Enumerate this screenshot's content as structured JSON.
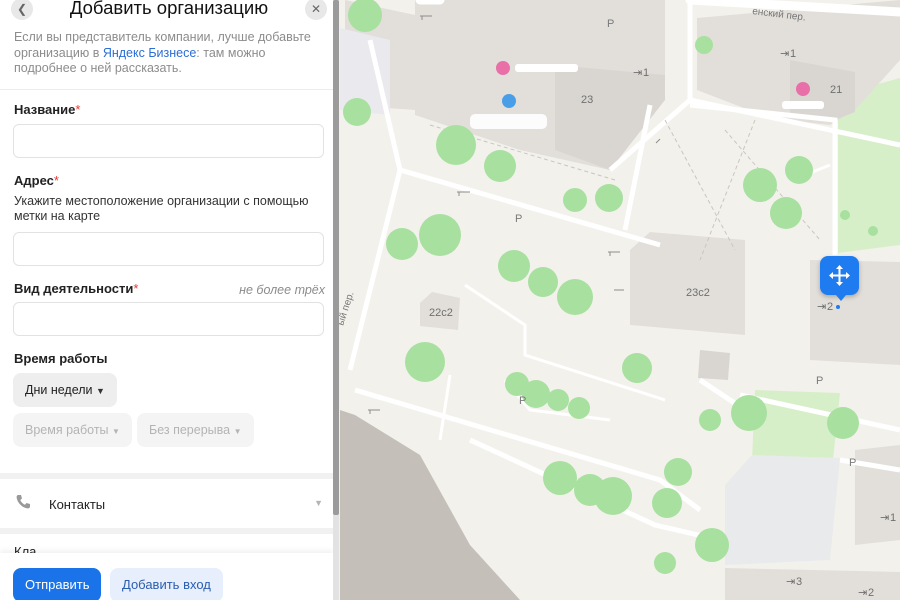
{
  "panel": {
    "title": "Добавить организацию",
    "intro_text": "Если вы представитель компании, лучше добавьте организацию в ",
    "intro_link": "Яндекс Бизнесе",
    "intro_rest": ": там можно подробнее о ней рассказать.",
    "name_label": "Название",
    "address_label": "Адрес",
    "address_hint": "Укажите местоположение организации с помощью метки на карте",
    "activity_label": "Вид деятельности",
    "activity_limit": "не более трёх",
    "hours_label": "Время работы",
    "days_label": "Дни недели",
    "work_time_label": "Время работы",
    "break_label": "Без перерыва",
    "contacts_label": "Контакты",
    "cut_row_label": "Кла",
    "submit_label": "Отправить",
    "add_entrance_label": "Добавить вход"
  },
  "map": {
    "street_labels": [
      "енский пер.",
      "ый пер."
    ],
    "buildings": [
      "23",
      "21",
      "22с2",
      "23с2"
    ],
    "entrances": [
      "1",
      "1",
      "2",
      "3",
      "2",
      "1"
    ],
    "colors": {
      "background": "#f3f1ec",
      "building": "#e2dfda",
      "tree": "#a8e0a0",
      "park": "#d7efc9",
      "accent": "#1f7cf0"
    }
  },
  "icons": [
    "back-icon",
    "close-icon",
    "phone-icon",
    "move-icon",
    "parking-icon",
    "entrance-icon",
    "barrier-icon",
    "poi-icon"
  ]
}
